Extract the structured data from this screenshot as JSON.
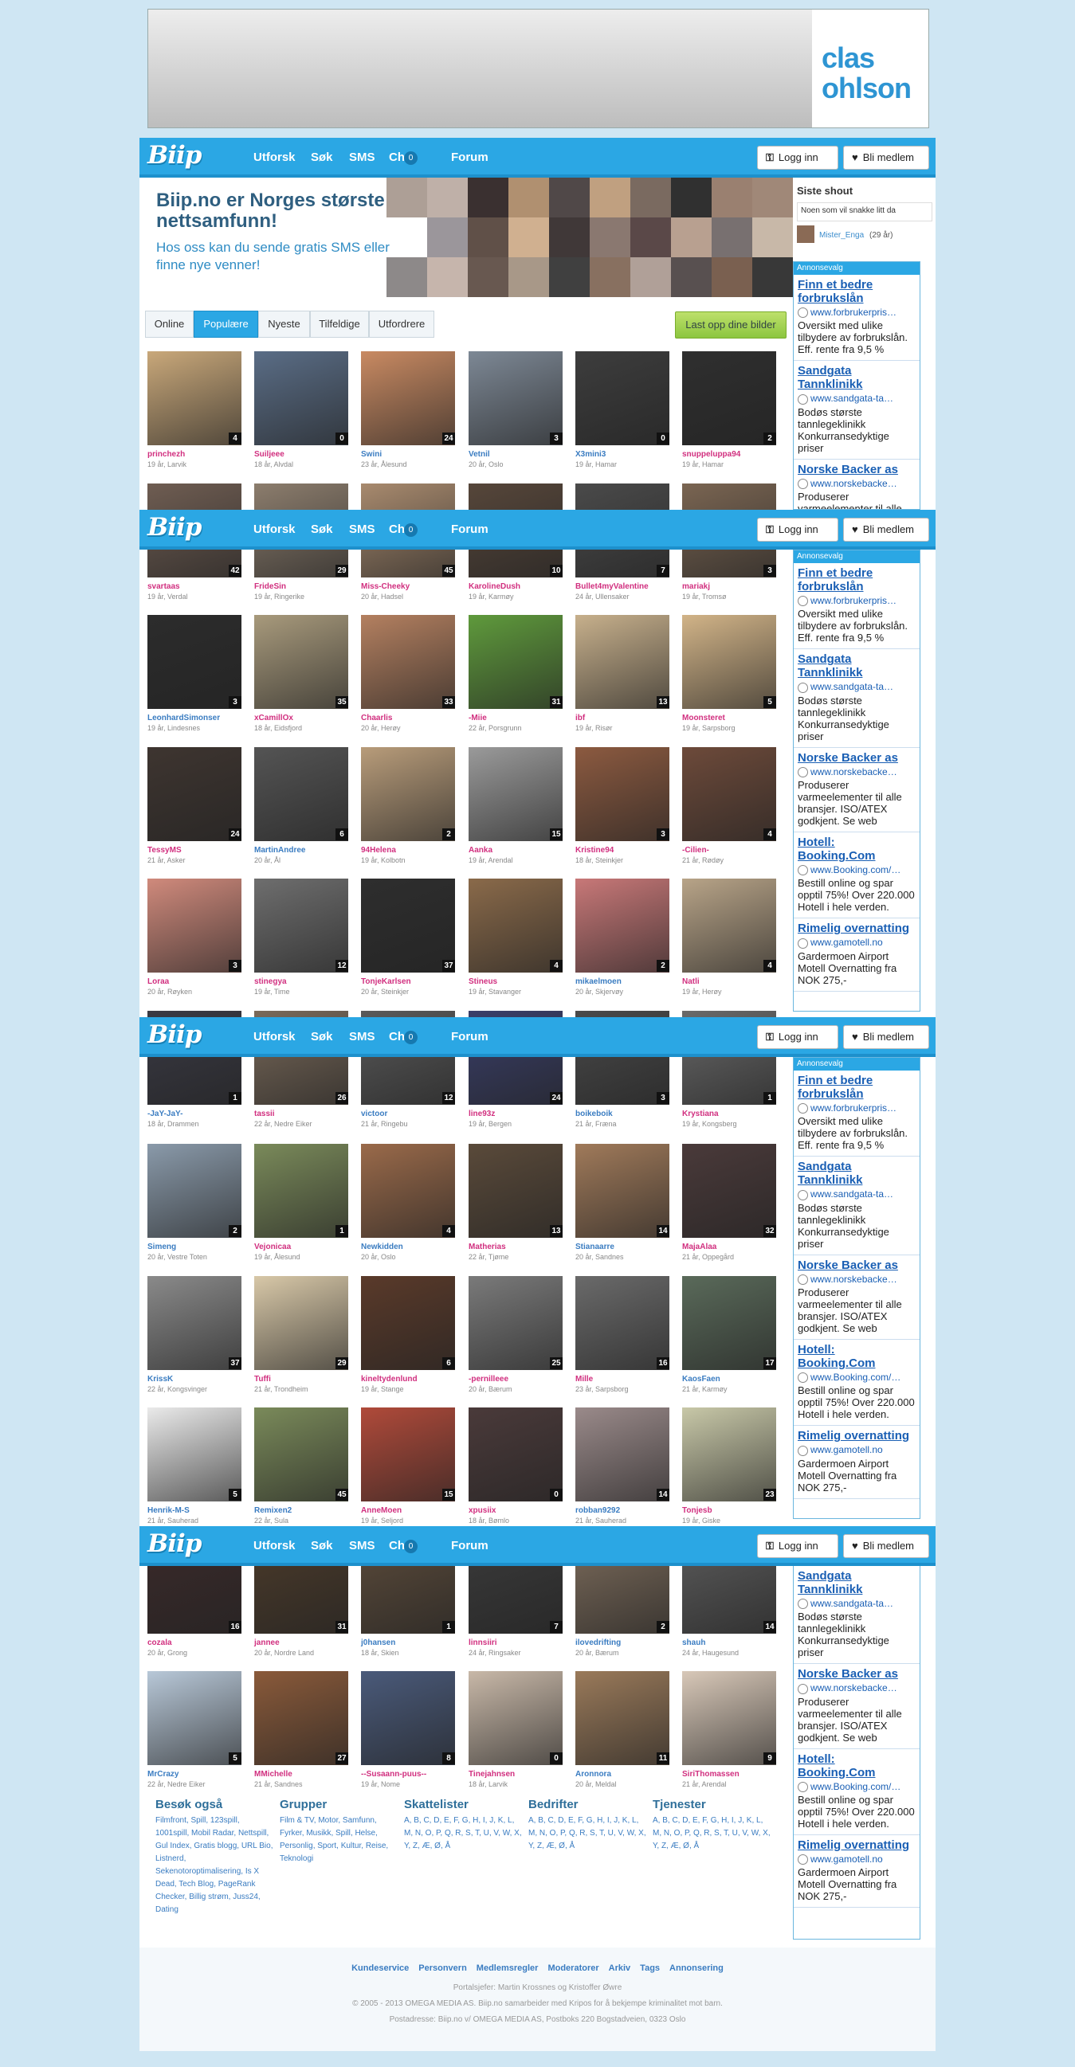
{
  "ad_banner": {
    "brand": "clas ohlson"
  },
  "nav": {
    "logo": "Biip",
    "links": [
      "Utforsk",
      "Søk",
      "SMS",
      "Chat",
      "Forum"
    ],
    "chat_count": "0",
    "login": "Logg inn",
    "signup": "Bli medlem"
  },
  "hero": {
    "title": "Biip.no er Norges største nettsamfunn!",
    "subtitle": "Hos oss kan du sende gratis SMS eller finne nye venner!"
  },
  "shout": {
    "heading": "Siste shout",
    "text": "Noen som vil snakke litt da",
    "user": "Mister_Enga",
    "age": "(29 år)"
  },
  "tabs": {
    "items": [
      "Online",
      "Populære",
      "Nyeste",
      "Tilfeldige",
      "Utfordrere"
    ],
    "upload": "Last opp dine bilder"
  },
  "sidebar_ads": {
    "header": "Annonsevalg",
    "items": [
      {
        "title": "Finn et bedre forbrukslån",
        "url": "www.forbrukerpris…",
        "desc": "Oversikt med ulike tilbydere av forbrukslån. Eff. rente fra 9,5 %"
      },
      {
        "title": "Sandgata Tannklinikk",
        "url": "www.sandgata-ta…",
        "desc": "Bodøs største tannlegeklinikk Konkurransedyktige priser"
      },
      {
        "title": "Norske Backer as",
        "url": "www.norskebacke…",
        "desc": "Produserer varmeelementer til alle bransjer. ISO/ATEX godkjent. Se web"
      },
      {
        "title": "Hotell: Booking.Com",
        "url": "www.Booking.com/…",
        "desc": "Bestill online og spar opptil 75%! Over 220.000 Hotell i hele verden."
      },
      {
        "title": "Rimelig overnatting",
        "url": "www.gamotell.no",
        "desc": "Gardermoen Airport Motell Overnatting fra NOK 275,-"
      }
    ]
  },
  "users": [
    {
      "name": "princhezh",
      "info": "19 år, Larvik",
      "count": "4",
      "g": "f",
      "c": "#c9a87a"
    },
    {
      "name": "Suiljeee",
      "info": "18 år, Alvdal",
      "count": "0",
      "g": "f",
      "c": "#5a6d86"
    },
    {
      "name": "Swini",
      "info": "23 år, Ålesund",
      "count": "24",
      "g": "m",
      "c": "#c98a62"
    },
    {
      "name": "Vetnil",
      "info": "20 år, Oslo",
      "count": "3",
      "g": "m",
      "c": "#7d8895"
    },
    {
      "name": "X3mini3",
      "info": "19 år, Hamar",
      "count": "0",
      "g": "m",
      "c": "#3d3d3d"
    },
    {
      "name": "snuppeluppa94",
      "info": "19 år, Hamar",
      "count": "2",
      "g": "f",
      "c": "#2f2f2f"
    },
    {
      "name": "svartaas",
      "info": "19 år, Verdal",
      "count": "42",
      "g": "f",
      "c": "#6f5d52"
    },
    {
      "name": "FrideSin",
      "info": "19 år, Ringerike",
      "count": "29",
      "g": "f",
      "c": "#8c7d6d"
    },
    {
      "name": "Miss-Cheeky",
      "info": "20 år, Hadsel",
      "count": "45",
      "g": "f",
      "c": "#a88a6e"
    },
    {
      "name": "KarolineDush",
      "info": "19 år, Karmøy",
      "count": "10",
      "g": "f",
      "c": "#56463a"
    },
    {
      "name": "Bullet4myValentine",
      "info": "24 år, Ullensaker",
      "count": "7",
      "g": "f",
      "c": "#4a4a4a"
    },
    {
      "name": "mariakj",
      "info": "19 år, Tromsø",
      "count": "3",
      "g": "f",
      "c": "#7a6552"
    },
    {
      "name": "LeonhardSimonser",
      "info": "19 år, Lindesnes",
      "count": "3",
      "g": "m",
      "c": "#2c2c2c"
    },
    {
      "name": "xCamillOx",
      "info": "18 år, Eidsfjord",
      "count": "35",
      "g": "f",
      "c": "#a89a7c"
    },
    {
      "name": "Chaarlis",
      "info": "20 år, Herøy",
      "count": "33",
      "g": "f",
      "c": "#b48060"
    },
    {
      "name": "-Miie",
      "info": "22 år, Porsgrunn",
      "count": "31",
      "g": "f",
      "c": "#5f9a3c"
    },
    {
      "name": "ibf",
      "info": "19 år, Risør",
      "count": "13",
      "g": "f",
      "c": "#c7b08c"
    },
    {
      "name": "Moonsteret",
      "info": "19 år, Sarpsborg",
      "count": "5",
      "g": "f",
      "c": "#d2b488"
    },
    {
      "name": "TessyMS",
      "info": "21 år, Asker",
      "count": "24",
      "g": "f",
      "c": "#3e3530"
    },
    {
      "name": "MartinAndree",
      "info": "20 år, Ål",
      "count": "6",
      "g": "m",
      "c": "#545454"
    },
    {
      "name": "94Helena",
      "info": "19 år, Kolbotn",
      "count": "2",
      "g": "f",
      "c": "#b89c7a"
    },
    {
      "name": "Aanka",
      "info": "19 år, Arendal",
      "count": "15",
      "g": "f",
      "c": "#9a9a9a"
    },
    {
      "name": "Kristine94",
      "info": "18 år, Steinkjer",
      "count": "3",
      "g": "f",
      "c": "#8c5a40"
    },
    {
      "name": "-Cilien-",
      "info": "21 år, Rødøy",
      "count": "4",
      "g": "f",
      "c": "#6d4a3a"
    },
    {
      "name": "Loraa",
      "info": "20 år, Røyken",
      "count": "3",
      "g": "f",
      "c": "#d08a7c"
    },
    {
      "name": "stinegya",
      "info": "19 år, Time",
      "count": "12",
      "g": "f",
      "c": "#6e6e6e"
    },
    {
      "name": "TonjeKarlsen",
      "info": "20 år, Steinkjer",
      "count": "37",
      "g": "f",
      "c": "#2e2e2e"
    },
    {
      "name": "Stineus",
      "info": "19 år, Stavanger",
      "count": "4",
      "g": "f",
      "c": "#8a6a4a"
    },
    {
      "name": "mikaelmoen",
      "info": "20 år, Skjervøy",
      "count": "2",
      "g": "m",
      "c": "#c87878"
    },
    {
      "name": "Natli",
      "info": "19 år, Herøy",
      "count": "4",
      "g": "f",
      "c": "#b8a488"
    },
    {
      "name": "-JaY-JaY-",
      "info": "18 år, Drammen",
      "count": "1",
      "g": "m",
      "c": "#3a3a44"
    },
    {
      "name": "tassii",
      "info": "22 år, Nedre Eiker",
      "count": "26",
      "g": "f",
      "c": "#7a6a5a"
    },
    {
      "name": "victoor",
      "info": "21 år, Ringebu",
      "count": "12",
      "g": "m",
      "c": "#5a5a5a"
    },
    {
      "name": "line93z",
      "info": "19 år, Bergen",
      "count": "24",
      "g": "f",
      "c": "#3a3f6a"
    },
    {
      "name": "boikeboik",
      "info": "21 år, Fræna",
      "count": "3",
      "g": "m",
      "c": "#4a4a4a"
    },
    {
      "name": "Krystiana",
      "info": "19 år, Kongsberg",
      "count": "1",
      "g": "f",
      "c": "#6a6a6a"
    },
    {
      "name": "Simeng",
      "info": "20 år, Vestre Toten",
      "count": "2",
      "g": "m",
      "c": "#8a9aaa"
    },
    {
      "name": "Vejonicaa",
      "info": "19 år, Ålesund",
      "count": "1",
      "g": "f",
      "c": "#7a8a5a"
    },
    {
      "name": "Newkidden",
      "info": "20 år, Oslo",
      "count": "4",
      "g": "m",
      "c": "#9a6a4a"
    },
    {
      "name": "Matherias",
      "info": "22 år, Tjøme",
      "count": "13",
      "g": "f",
      "c": "#5a4a3a"
    },
    {
      "name": "Stianaarre",
      "info": "20 år, Sandnes",
      "count": "14",
      "g": "m",
      "c": "#a07a5a"
    },
    {
      "name": "MajaAlaa",
      "info": "21 år, Oppegård",
      "count": "32",
      "g": "f",
      "c": "#4a3a3a"
    },
    {
      "name": "KrissK",
      "info": "22 år, Kongsvinger",
      "count": "37",
      "g": "m",
      "c": "#8a8a8a"
    },
    {
      "name": "Tuffi",
      "info": "21 år, Trondheim",
      "count": "29",
      "g": "f",
      "c": "#d8c8a8"
    },
    {
      "name": "kineltydenlund",
      "info": "19 år, Stange",
      "count": "6",
      "g": "f",
      "c": "#5a3a2a"
    },
    {
      "name": "-pernilleee",
      "info": "20 år, Bærum",
      "count": "25",
      "g": "f",
      "c": "#7a7a7a"
    },
    {
      "name": "Mille",
      "info": "23 år, Sarpsborg",
      "count": "16",
      "g": "f",
      "c": "#6a6a6a"
    },
    {
      "name": "KaosFaen",
      "info": "21 år, Karmøy",
      "count": "17",
      "g": "m",
      "c": "#5a6a5a"
    },
    {
      "name": "Henrik-M-S",
      "info": "21 år, Sauherad",
      "count": "5",
      "g": "m",
      "c": "#eaeaea"
    },
    {
      "name": "Remixen2",
      "info": "22 år, Sula",
      "count": "45",
      "g": "m",
      "c": "#7a8a5a"
    },
    {
      "name": "AnneMoen",
      "info": "19 år, Seljord",
      "count": "15",
      "g": "f",
      "c": "#b04a3a"
    },
    {
      "name": "xpusiix",
      "info": "18 år, Bømlo",
      "count": "0",
      "g": "f",
      "c": "#4a3a3a"
    },
    {
      "name": "robban9292",
      "info": "21 år, Sauherad",
      "count": "14",
      "g": "m",
      "c": "#9a8a8a"
    },
    {
      "name": "Tonjesb",
      "info": "19 år, Giske",
      "count": "23",
      "g": "f",
      "c": "#c8c8a8"
    },
    {
      "name": "cozala",
      "info": "20 år, Grong",
      "count": "16",
      "g": "f",
      "c": "#3a2a2a"
    },
    {
      "name": "jannee",
      "info": "20 år, Nordre Land",
      "count": "31",
      "g": "f",
      "c": "#4a3a2a"
    },
    {
      "name": "j0hansen",
      "info": "18 år, Skien",
      "count": "1",
      "g": "m",
      "c": "#5a4a3a"
    },
    {
      "name": "linnsiiri",
      "info": "24 år, Ringsaker",
      "count": "7",
      "g": "f",
      "c": "#3a3a3a"
    },
    {
      "name": "ilovedrifting",
      "info": "20 år, Bærum",
      "count": "2",
      "g": "m",
      "c": "#7a6a5a"
    },
    {
      "name": "shauh",
      "info": "24 år, Haugesund",
      "count": "14",
      "g": "m",
      "c": "#5a5a5a"
    },
    {
      "name": "MrCrazy",
      "info": "22 år, Nedre Eiker",
      "count": "5",
      "g": "m",
      "c": "#b8c8d8"
    },
    {
      "name": "MMichelle",
      "info": "21 år, Sandnes",
      "count": "27",
      "g": "f",
      "c": "#8a5a3a"
    },
    {
      "name": "--Susaann-puus--",
      "info": "19 år, Nome",
      "count": "8",
      "g": "f",
      "c": "#4a5a7a"
    },
    {
      "name": "Tinejahnsen",
      "info": "18 år, Larvik",
      "count": "0",
      "g": "f",
      "c": "#c8b8a8"
    },
    {
      "name": "Aronnora",
      "info": "20 år, Meldal",
      "count": "11",
      "g": "m",
      "c": "#9a7a5a"
    },
    {
      "name": "SiriThomassen",
      "info": "21 år, Arendal",
      "count": "9",
      "g": "f",
      "c": "#d8c8b8"
    }
  ],
  "footer_cols": [
    {
      "heading": "Besøk også",
      "text": "Filmfront, Spill, 123spill, 1001spill, Mobil Radar, Nettspill, Gul Index, Gratis blogg, URL Bio, Listnerd, Sekenotoroptimalisering, Is X Dead, Tech Blog, PageRank Checker, Billig strøm, Juss24, Dating"
    },
    {
      "heading": "Grupper",
      "text": "Film & TV, Motor, Samfunn, Fyrker, Musikk, Spill, Helse, Personlig, Sport, Kultur, Reise, Teknologi"
    },
    {
      "heading": "Skattelister",
      "text": "A, B, C, D, E, F, G, H, I, J, K, L, M, N, O, P, Q, R, S, T, U, V, W, X, Y, Z, Æ, Ø, Å"
    },
    {
      "heading": "Bedrifter",
      "text": "A, B, C, D, E, F, G, H, I, J, K, L, M, N, O, P, Q, R, S, T, U, V, W, X, Y, Z, Æ, Ø, Å"
    },
    {
      "heading": "Tjenester",
      "text": "A, B, C, D, E, F, G, H, I, J, K, L, M, N, O, P, Q, R, S, T, U, V, W, X, Y, Z, Æ, Ø, Å"
    }
  ],
  "footer": {
    "links": [
      "Kundeservice",
      "Personvern",
      "Medlemsregler",
      "Moderatorer",
      "Arkiv",
      "Tags",
      "Annonsering"
    ],
    "portal": "Portalsjefer: Martin Krossnes og Kristoffer Øwre",
    "copyright": "© 2005 - 2013 OMEGA MEDIA AS. Biip.no samarbeider med Kripos for å bekjempe kriminalitet mot barn.",
    "address": "Postadresse: Biip.no v/ OMEGA MEDIA AS, Postboks 220 Bogstadveien, 0323 Oslo"
  },
  "mosaic_colors": [
    "#6a5040",
    "#8a7060",
    "#3a3030",
    "#b09070",
    "#504848",
    "#c0a080",
    "#7a6a60",
    "#303030",
    "#9a8070",
    "#a08878",
    "#484048",
    "#605048",
    "#d0b090",
    "#403838",
    "#8a7870",
    "#5a4848",
    "#b8a090",
    "#787070",
    "#c8b8a8",
    "#302828",
    "#987868",
    "#685850",
    "#a89888",
    "#404040",
    "#887060",
    "#b0a098",
    "#585050",
    "#7a6050",
    "#383838",
    "#c0a890",
    "#685858",
    "#988070",
    "#484040",
    "#a08070",
    "#787878",
    "#302020",
    "#b09880",
    "#605858",
    "#8a6a58",
    "#d0c0b0"
  ]
}
